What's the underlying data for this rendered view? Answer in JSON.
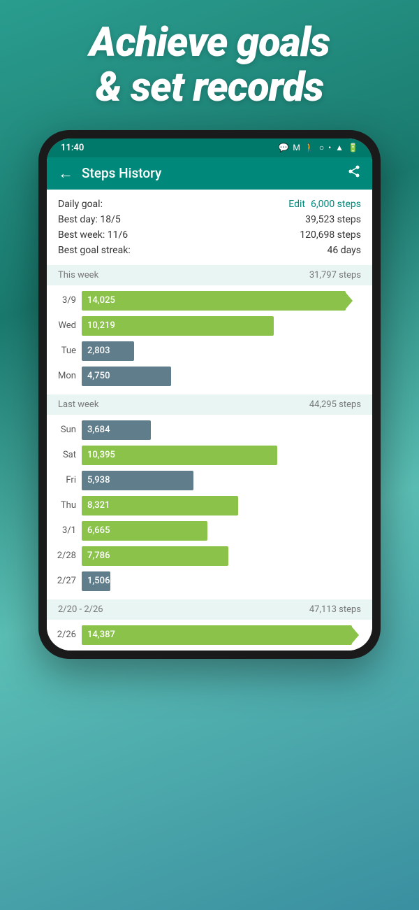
{
  "hero": {
    "line1": "Achieve goals",
    "line2": "& set records"
  },
  "status_bar": {
    "time": "11:40",
    "icons": "📶 🔋"
  },
  "app_bar": {
    "title": "Steps History",
    "back_label": "←",
    "share_label": "share"
  },
  "stats": {
    "daily_goal_label": "Daily goal:",
    "daily_goal_edit": "Edit",
    "daily_goal_value": "6,000 steps",
    "best_day_label": "Best day: 18/5",
    "best_day_value": "39,523 steps",
    "best_week_label": "Best week: 11/6",
    "best_week_value": "120,698 steps",
    "best_streak_label": "Best goal streak:",
    "best_streak_value": "46 days"
  },
  "this_week": {
    "label": "This week",
    "total": "31,797 steps",
    "bars": [
      {
        "day": "3/9",
        "value": 14025,
        "label": "14,025",
        "max": 15000,
        "type": "green",
        "arrow": true
      },
      {
        "day": "Wed",
        "value": 10219,
        "label": "10,219",
        "max": 15000,
        "type": "green",
        "arrow": false
      },
      {
        "day": "Tue",
        "value": 2803,
        "label": "2,803",
        "max": 15000,
        "type": "steel",
        "arrow": false
      },
      {
        "day": "Mon",
        "value": 4750,
        "label": "4,750",
        "max": 15000,
        "type": "steel",
        "arrow": false
      }
    ]
  },
  "last_week": {
    "label": "Last week",
    "total": "44,295 steps",
    "bars": [
      {
        "day": "Sun",
        "value": 3684,
        "label": "3,684",
        "max": 15000,
        "type": "steel",
        "arrow": false
      },
      {
        "day": "Sat",
        "value": 10395,
        "label": "10,395",
        "max": 15000,
        "type": "green",
        "arrow": false
      },
      {
        "day": "Fri",
        "value": 5938,
        "label": "5,938",
        "max": 15000,
        "type": "steel",
        "arrow": false
      },
      {
        "day": "Thu",
        "value": 8321,
        "label": "8,321",
        "max": 15000,
        "type": "green",
        "arrow": false
      },
      {
        "day": "3/1",
        "value": 6665,
        "label": "6,665",
        "max": 15000,
        "type": "green",
        "arrow": false
      },
      {
        "day": "2/28",
        "value": 7786,
        "label": "7,786",
        "max": 15000,
        "type": "green",
        "arrow": false
      },
      {
        "day": "2/27",
        "value": 1506,
        "label": "1,506",
        "max": 15000,
        "type": "steel",
        "arrow": false
      }
    ]
  },
  "week_2": {
    "label": "2/20 - 2/26",
    "total": "47,113 steps",
    "bars": [
      {
        "day": "2/26",
        "value": 14387,
        "label": "14,387",
        "max": 15000,
        "type": "green",
        "arrow": true
      }
    ]
  },
  "colors": {
    "teal": "#00897b",
    "green_bar": "#8bc34a",
    "steel_bar": "#607d8b",
    "week_bg": "#e8f5f3"
  }
}
